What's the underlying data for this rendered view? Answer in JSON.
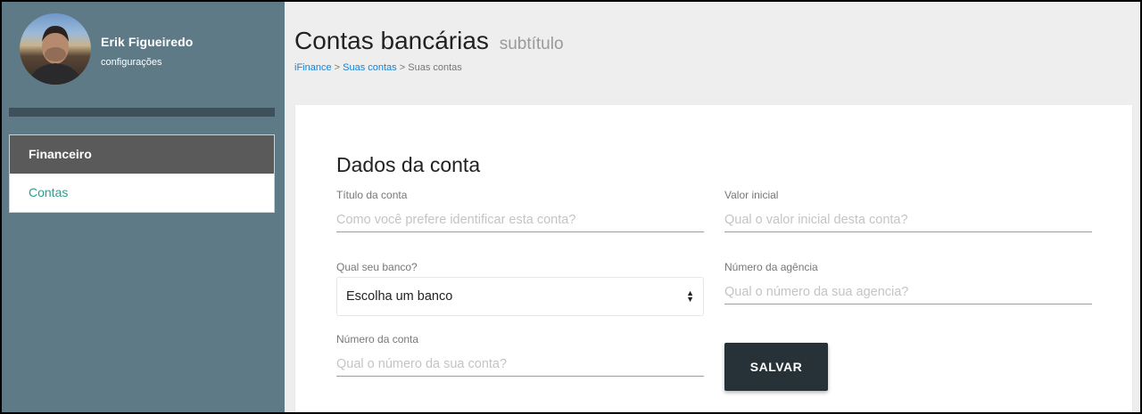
{
  "user": {
    "name": "Erik Figueiredo",
    "subtitle": "configurações"
  },
  "sidebar": {
    "menu_header": "Financeiro",
    "items": [
      {
        "label": "Contas"
      }
    ]
  },
  "header": {
    "title": "Contas bancárias",
    "subtitle": "subtítulo",
    "breadcrumb": [
      {
        "label": "iFinance",
        "link": true
      },
      {
        "label": "Suas contas",
        "link": true
      },
      {
        "label": "Suas contas",
        "link": false
      }
    ],
    "separator": ">"
  },
  "form": {
    "title": "Dados da conta",
    "titulo_label": "Título da conta",
    "titulo_placeholder": "Como você prefere identificar esta conta?",
    "valor_label": "Valor inicial",
    "valor_placeholder": "Qual o valor inicial desta conta?",
    "banco_label": "Qual seu banco?",
    "banco_selected": "Escolha um banco",
    "agencia_label": "Número da agência",
    "agencia_placeholder": "Qual o número da sua agencia?",
    "conta_label": "Número da conta",
    "conta_placeholder": "Qual o número da sua conta?",
    "save_label": "SALVAR"
  },
  "colors": {
    "sidebar_bg": "#5e7a86",
    "menu_header_bg": "#5a5a5a",
    "accent_link": "#2a9d8f",
    "breadcrumb_link": "#1a7fd0",
    "button_bg": "#263238"
  },
  "icons": {
    "select_arrows": "sort-arrows-icon"
  }
}
